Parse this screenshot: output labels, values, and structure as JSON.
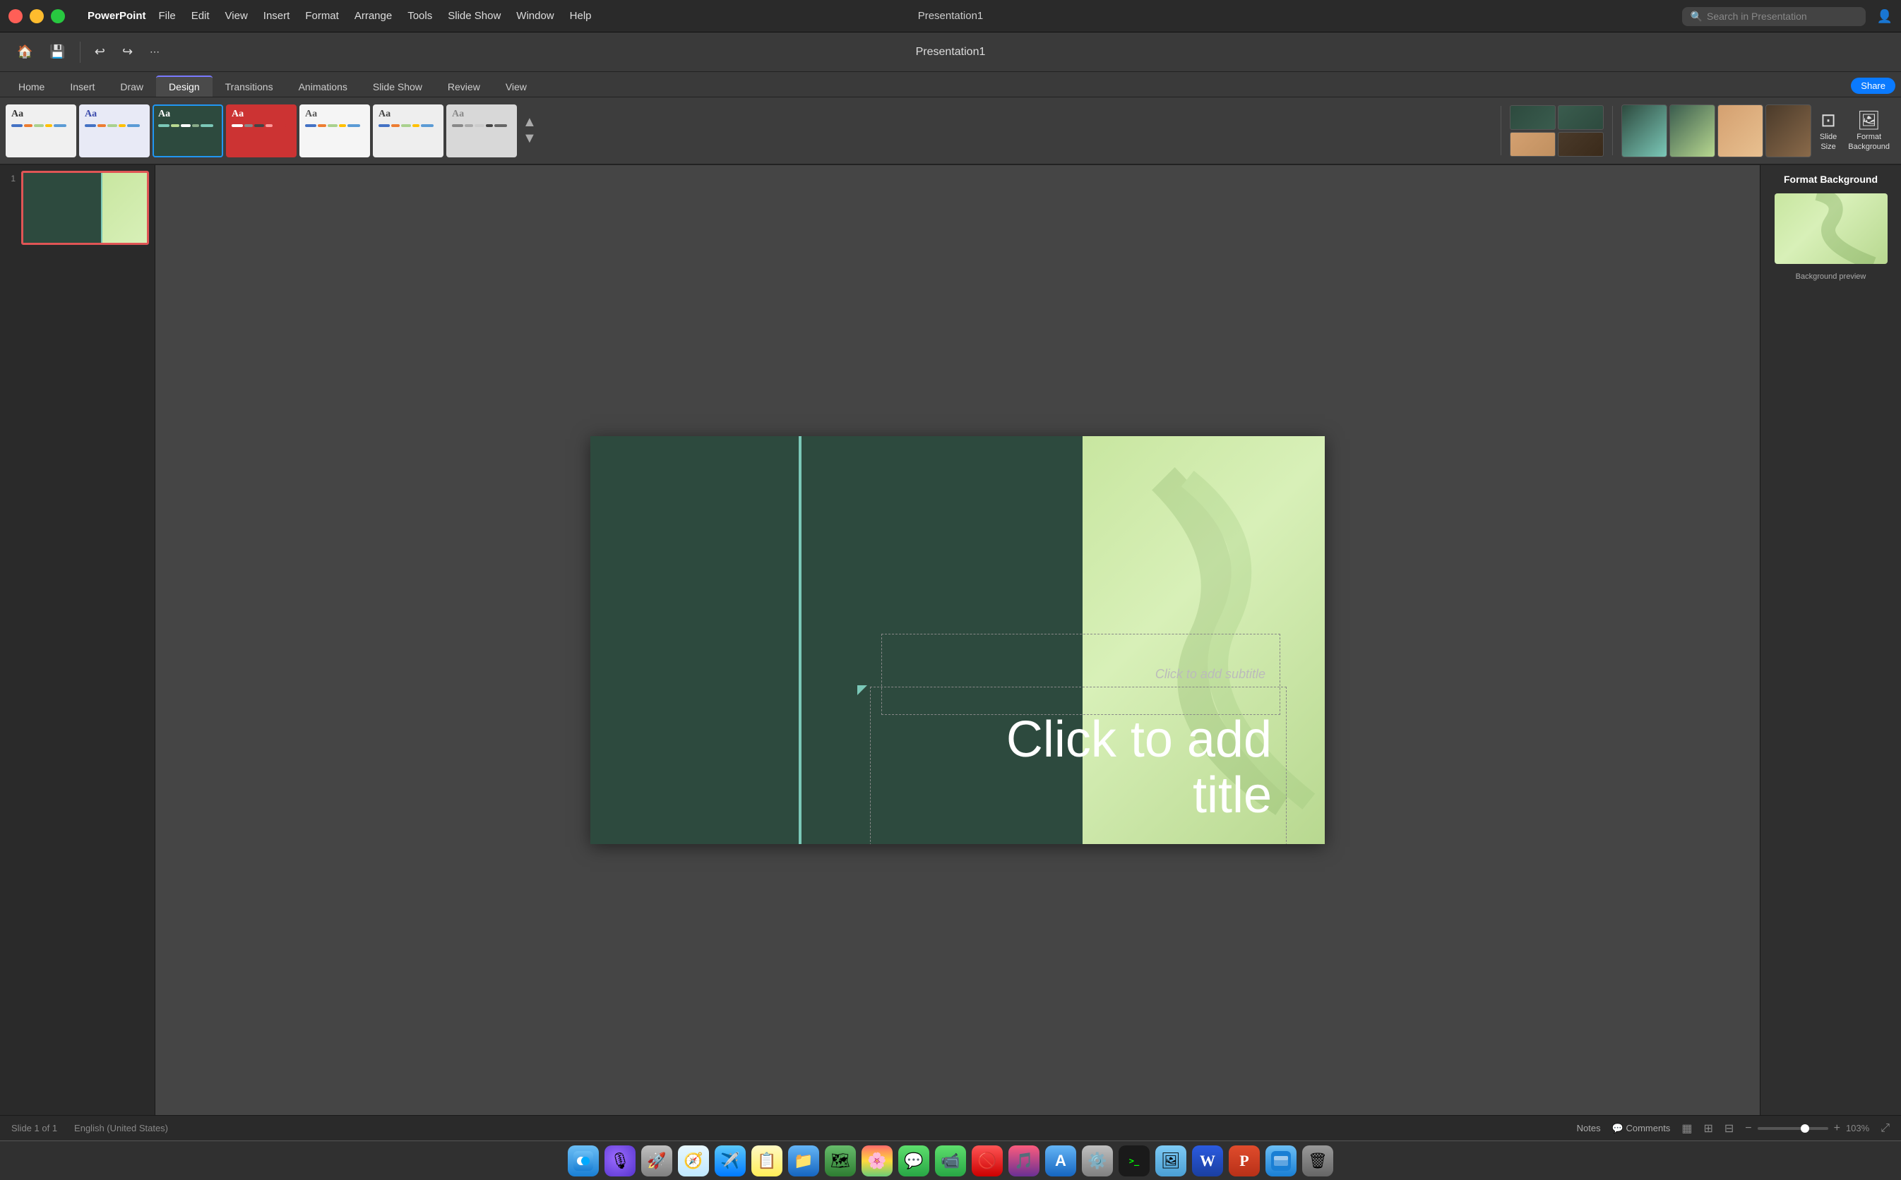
{
  "app": {
    "name": "PowerPoint",
    "title": "Presentation1"
  },
  "menubar": {
    "apple_logo": "",
    "items": [
      {
        "label": "PowerPoint",
        "id": "app-menu"
      },
      {
        "label": "File",
        "id": "file-menu"
      },
      {
        "label": "Edit",
        "id": "edit-menu"
      },
      {
        "label": "View",
        "id": "view-menu"
      },
      {
        "label": "Insert",
        "id": "insert-menu"
      },
      {
        "label": "Format",
        "id": "format-menu"
      },
      {
        "label": "Arrange",
        "id": "arrange-menu"
      },
      {
        "label": "Tools",
        "id": "tools-menu"
      },
      {
        "label": "Slide Show",
        "id": "slideshow-menu"
      },
      {
        "label": "Window",
        "id": "window-menu"
      },
      {
        "label": "Help",
        "id": "help-menu"
      }
    ],
    "search_placeholder": "Search in Presentation"
  },
  "toolbar": {
    "undo_label": "↩",
    "redo_label": "↩",
    "more_label": "⋯"
  },
  "ribbon": {
    "tabs": [
      {
        "label": "Home",
        "active": false
      },
      {
        "label": "Insert",
        "active": false
      },
      {
        "label": "Draw",
        "active": false
      },
      {
        "label": "Design",
        "active": true
      },
      {
        "label": "Transitions",
        "active": false
      },
      {
        "label": "Animations",
        "active": false
      },
      {
        "label": "Slide Show",
        "active": false
      },
      {
        "label": "Review",
        "active": false
      },
      {
        "label": "View",
        "active": false
      }
    ],
    "share_label": "Share",
    "themes": [
      {
        "id": "theme-1",
        "label": "Aa",
        "bg": "#f5f5f5",
        "text": "#333",
        "bars": [
          "#4472C4",
          "#ED7D31",
          "#A9D18E",
          "#FFC000",
          "#5B9BD5"
        ]
      },
      {
        "id": "theme-2",
        "label": "Aa",
        "bg": "#e8e8e8",
        "text": "#333",
        "bars": [
          "#4472C4",
          "#ED7D31",
          "#A9D18E",
          "#FFC000",
          "#5B9BD5"
        ]
      },
      {
        "id": "theme-3",
        "label": "Aa",
        "bg": "#d0d0d0",
        "text": "#333",
        "bars": [
          "#2d4a3e",
          "#7bc8b8",
          "#b8d890",
          "#fff",
          "#88aa88"
        ],
        "selected": true
      },
      {
        "id": "theme-4",
        "label": "Aa",
        "bg": "#cc3333",
        "text": "#fff",
        "bars": [
          "#cc3333",
          "#fff",
          "#888",
          "#444",
          "#ff9999"
        ]
      },
      {
        "id": "theme-5",
        "label": "Aa",
        "bg": "#f0f0f0",
        "text": "#333",
        "bars": [
          "#4472C4",
          "#ED7D31",
          "#A9D18E",
          "#FFC000",
          "#5B9BD5"
        ]
      },
      {
        "id": "theme-6",
        "label": "Aa",
        "bg": "#e0e0e0",
        "text": "#333",
        "bars": [
          "#4472C4",
          "#ED7D31",
          "#A9D18E",
          "#FFC000",
          "#5B9BD5"
        ]
      },
      {
        "id": "theme-7",
        "label": "Aa",
        "bg": "#d8d8d8",
        "text": "#888",
        "bars": [
          "#888",
          "#aaa",
          "#ccc",
          "#444",
          "#666"
        ]
      }
    ],
    "variants": [
      {
        "id": "variant-1",
        "bg": "#2d4a3e"
      },
      {
        "id": "variant-2",
        "bg": "#3a5c4e"
      },
      {
        "id": "variant-3",
        "bg": "#d4a070"
      },
      {
        "id": "variant-4",
        "bg": "#4a3a2a"
      }
    ],
    "slide_size_label": "Slide\nSize",
    "format_bg_label": "Format\nBackground"
  },
  "slide": {
    "number": "1",
    "subtitle_placeholder": "Click to add subtitle",
    "title_placeholder": "Click to add\ntitle"
  },
  "format_bg_panel": {
    "title": "Format Background"
  },
  "status": {
    "slide_info": "Slide 1 of 1",
    "language": "English (United States)",
    "notes_label": "Notes",
    "comments_label": "Comments",
    "zoom_value": "103%",
    "zoom_pct": 103
  },
  "dock": {
    "icons": [
      {
        "id": "finder",
        "label": "🔵",
        "class": "di-finder"
      },
      {
        "id": "siri",
        "label": "🟣",
        "class": "di-siri"
      },
      {
        "id": "launchpad",
        "label": "🚀",
        "class": "di-rocket"
      },
      {
        "id": "safari",
        "label": "🧭",
        "class": "di-safari"
      },
      {
        "id": "mail",
        "label": "✉",
        "class": "di-mail"
      },
      {
        "id": "stickies",
        "label": "📝",
        "class": "di-notes"
      },
      {
        "id": "files",
        "label": "📁",
        "class": "di-files"
      },
      {
        "id": "maps",
        "label": "🗺",
        "class": "di-maps"
      },
      {
        "id": "photos",
        "label": "🌸",
        "class": "di-photos"
      },
      {
        "id": "messages",
        "label": "💬",
        "class": "di-messages"
      },
      {
        "id": "facetime",
        "label": "📹",
        "class": "di-facetime"
      },
      {
        "id": "donotdist",
        "label": "🚫",
        "class": "di-donotdist"
      },
      {
        "id": "music",
        "label": "🎵",
        "class": "di-music"
      },
      {
        "id": "appstore",
        "label": "🅰",
        "class": "di-appstore"
      },
      {
        "id": "system",
        "label": "⚙",
        "class": "di-system"
      },
      {
        "id": "terminal",
        "label": ">_",
        "class": "di-terminal"
      },
      {
        "id": "preview",
        "label": "🖼",
        "class": "di-preview"
      },
      {
        "id": "word",
        "label": "W",
        "class": "di-word"
      },
      {
        "id": "ppt",
        "label": "P",
        "class": "di-ppt"
      },
      {
        "id": "finder2",
        "label": "🔵",
        "class": "di-finder2"
      },
      {
        "id": "trash",
        "label": "🗑",
        "class": "di-trash"
      }
    ]
  }
}
